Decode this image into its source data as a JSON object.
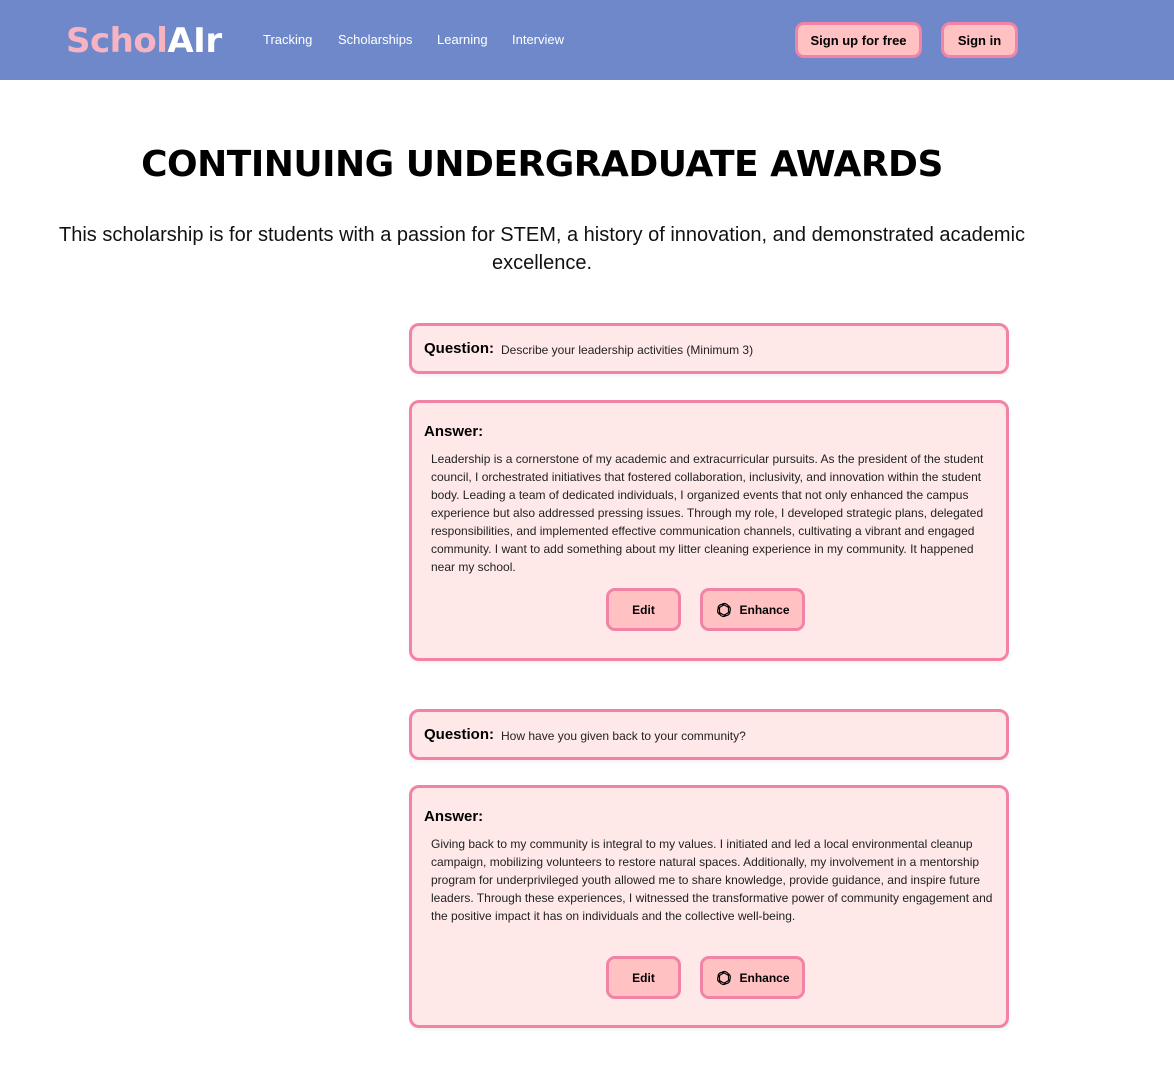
{
  "nav": {
    "logo_part1": "Schol",
    "logo_part2": "AIr",
    "links": [
      "Tracking",
      "Scholarships",
      "Learning",
      "Interview"
    ],
    "signup_label": "Sign up for free",
    "signin_label": "Sign in"
  },
  "page": {
    "title": "CONTINUING UNDERGRADUATE AWARDS",
    "description": "This scholarship is for students with a passion for STEM, a history of innovation, and demonstrated academic excellence."
  },
  "qa": [
    {
      "question_label": "Question:",
      "question": "Describe your leadership activities (Minimum 3)",
      "answer_label": "Answer:",
      "answer": "Leadership is a cornerstone of my academic and extracurricular pursuits. As the president of the student council, I orchestrated initiatives that fostered collaboration, inclusivity, and innovation within the student body. Leading a team of dedicated individuals, I organized events that not only enhanced the campus experience but also addressed pressing issues. Through my role, I developed strategic plans, delegated responsibilities, and implemented effective communication channels, cultivating a vibrant and engaged community. I want to add something about my litter cleaning experience in my community. It happened near my school.",
      "edit_label": "Edit",
      "enhance_label": "Enhance"
    },
    {
      "question_label": "Question:",
      "question": "How have you given back to your community?",
      "answer_label": "Answer:",
      "answer": "Giving back to my community is integral to my values. I initiated and led a local environmental cleanup campaign, mobilizing volunteers to restore natural spaces. Additionally, my involvement in a mentorship program for underprivileged youth allowed me to share knowledge, provide guidance, and inspire future leaders. Through these experiences, I witnessed the transformative power of community engagement and the positive impact it has on individuals and the collective well-being.",
      "edit_label": "Edit",
      "enhance_label": "Enhance"
    }
  ],
  "icons": {
    "enhance": "openai-icon"
  },
  "colors": {
    "navbar": "#6f88c9",
    "logo_accent": "#f7b3c1",
    "button_fill": "#ffc1c1",
    "button_border": "#f283a6",
    "card_fill": "#fee8e8",
    "card_border": "#f283a6"
  }
}
